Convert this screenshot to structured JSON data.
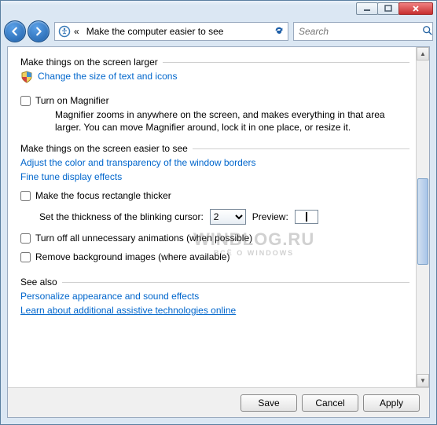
{
  "titlebar": {},
  "nav": {
    "chevrons": "«",
    "address": "Make the computer easier to see",
    "search_placeholder": "Search"
  },
  "sections": {
    "larger": {
      "title": "Make things on the screen larger",
      "link_change_size": "Change the size of text and icons",
      "chk_magnifier": "Turn on Magnifier",
      "magnifier_desc": "Magnifier zooms in anywhere on the screen, and makes everything in that area larger. You can move Magnifier around, lock it in one place, or resize it."
    },
    "easier": {
      "title": "Make things on the screen easier to see",
      "link_color": "Adjust the color and transparency of the window borders",
      "link_finetune": "Fine tune display effects",
      "chk_focus": "Make the focus rectangle thicker",
      "cursor_label": "Set the thickness of the blinking cursor:",
      "cursor_value": "2",
      "preview_label": "Preview:",
      "chk_anim": "Turn off all unnecessary animations (when possible)",
      "chk_bg": "Remove background images (where available)"
    },
    "seealso": {
      "title": "See also",
      "link_personalize": "Personalize appearance and sound effects",
      "link_learn": "Learn about additional assistive technologies online"
    }
  },
  "buttons": {
    "save": "Save",
    "cancel": "Cancel",
    "apply": "Apply"
  },
  "watermark": {
    "main": "WINBLOG.RU",
    "sub": "ВСЁ О WINDOWS"
  }
}
